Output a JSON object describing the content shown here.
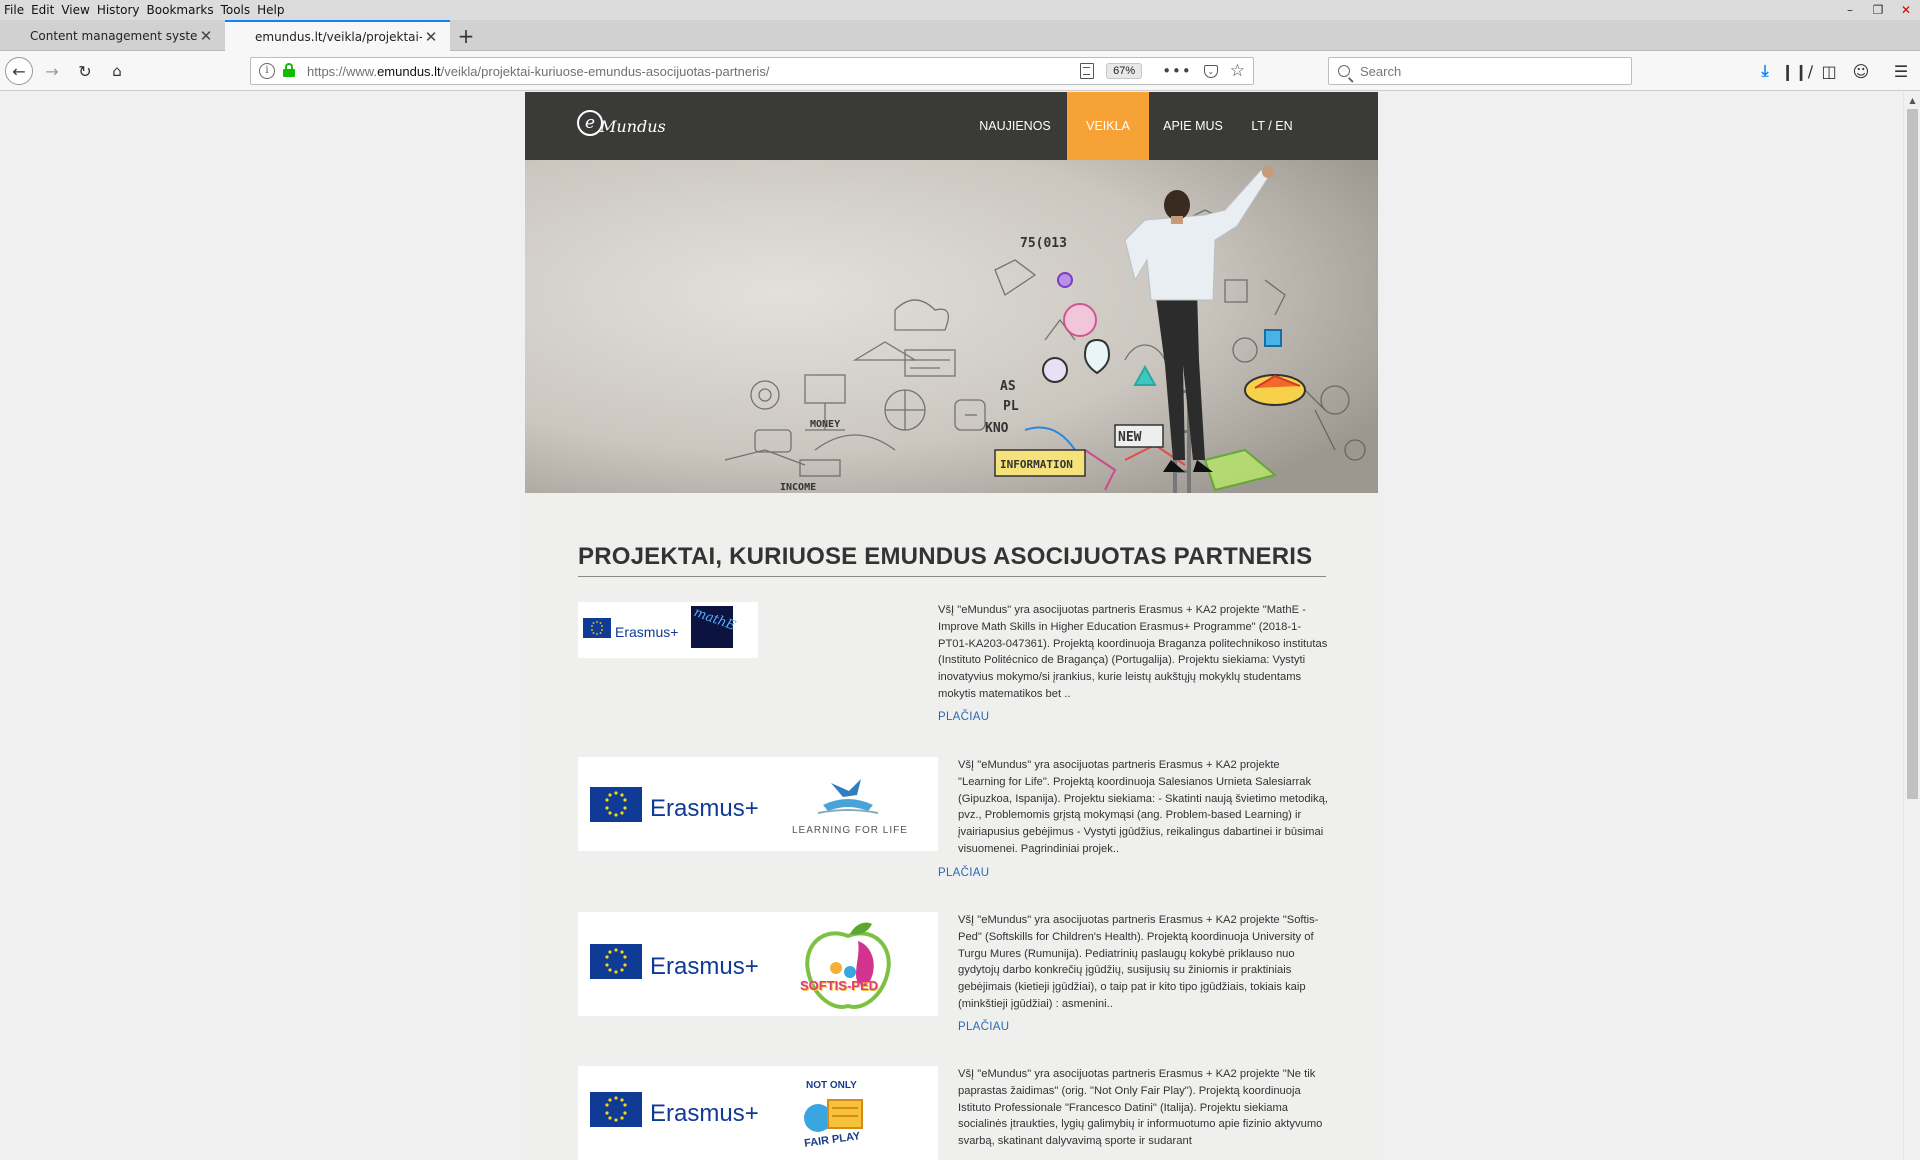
{
  "menubar": {
    "items": [
      {
        "label": "File"
      },
      {
        "label": "Edit"
      },
      {
        "label": "View"
      },
      {
        "label": "History"
      },
      {
        "label": "Bookmarks"
      },
      {
        "label": "Tools"
      },
      {
        "label": "Help"
      }
    ]
  },
  "tabs": [
    {
      "title": "Content management system"
    },
    {
      "title": "emundus.lt/veikla/projektai-ku"
    }
  ],
  "url": {
    "prefix": "https://www.",
    "domain": "emundus.lt",
    "path": "/veikla/projektai-kuriuose-emundus-asocijuotas-partneris/"
  },
  "zoom": "67%",
  "search": {
    "placeholder": "Search"
  },
  "colors": {
    "accent": "#f7a234",
    "header_bg": "#3a3a39",
    "link": "#2a6ab0",
    "eu_blue": "#0f3a96"
  },
  "site": {
    "logo_text": "Mundus",
    "nav": [
      {
        "label": "NAUJIENOS",
        "active": false
      },
      {
        "label": "VEIKLA",
        "active": true
      },
      {
        "label": "APIE MUS",
        "active": false
      },
      {
        "label": "LT / EN",
        "active": false
      }
    ]
  },
  "hero": {
    "labels": [
      "INFORMATION",
      "NEW",
      "MONEY",
      "AS",
      "PL",
      "KNO",
      "75(013",
      "INCOME"
    ]
  },
  "page": {
    "title": "PROJEKTAI, KURIUOSE EMUNDUS ASOCIJUOTAS PARTNERIS"
  },
  "projects": [
    {
      "logo_label": "Erasmus+",
      "partner_logo": "mathE",
      "description": "VšĮ \"eMundus\" yra asocijuotas partneris Erasmus + KA2 projekte \"MathE - Improve Math Skills in Higher Education Erasmus+ Programme\" (2018-1-PT01-KA203-047361). Projektą koordinuoja Braganza politechnikoso institutas (Instituto Politécnico de Bragança) (Portugalija). Projektu siekiama: Vystyti inovatyvius mokymo/si įrankius, kurie leistų aukštųjų mokyklų studentams mokytis matematikos bet ..",
      "more": "PLAČIAU"
    },
    {
      "logo_label": "Erasmus+",
      "partner_logo": "LEARNING FOR LIFE",
      "description": "VšĮ \"eMundus\" yra asocijuotas partneris Erasmus + KA2 projekte \"Learning for Life\". Projektą koordinuoja  Salesianos Urnieta Salesiarrak (Gipuzkoa, Ispanija). Projektu siekiama: - Skatinti naują švietimo metodiką, pvz., Problemomis grįstą mokymąsi (ang. Problem-based Learning) ir įvairiapusius gebėjimus - Vystyti įgūdžius, reikalingus dabartinei ir būsimai visuomenei. Pagrindiniai projek..",
      "more": "PLAČIAU"
    },
    {
      "logo_label": "Erasmus+",
      "partner_logo": "SOFTIS-PED",
      "description": "VšĮ \"eMundus\" yra asocijuotas partneris Erasmus + KA2 projekte \"Softis-Ped\" (Softskills for Children's Health). Projektą koordinuoja  University of Turgu Mures (Rumunija). Pediatrinių paslaugų kokybė priklauso nuo gydytojų darbo konkrečių įgūdžių, susijusių su žiniomis ir praktiniais gebėjimais (kietieji įgūdžiai), o taip pat ir kito tipo įgūdžiais, tokiais kaip (minkštieji įgūdžiai) : asmenini..",
      "more": "PLAČIAU"
    },
    {
      "logo_label": "Erasmus+",
      "partner_logo_line1": "NOT ONLY",
      "partner_logo_line2": "FAIR PLAY",
      "description": "VšĮ \"eMundus\" yra asocijuotas partneris Erasmus + KA2 projekte \"Ne tik paprastas žaidimas\" (orig. \"Not Only Fair Play\"). Projektą koordinuoja Istituto Professionale \"Francesco Datini\" (Italija). Projektu siekiama socialinės įtraukties, lygių galimybių ir informuotumo apie fizinio aktyvumo svarbą, skatinant dalyvavimą sporte ir sudarant"
    }
  ]
}
